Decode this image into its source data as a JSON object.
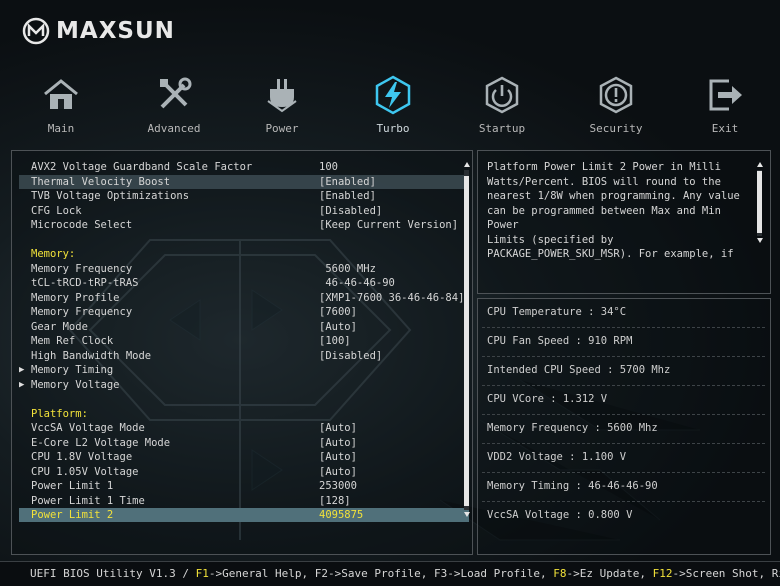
{
  "brand": {
    "name": "MAXSUN"
  },
  "nav": [
    {
      "label": "Main",
      "icon": "house-icon"
    },
    {
      "label": "Advanced",
      "icon": "tools-icon"
    },
    {
      "label": "Power",
      "icon": "power-plug-icon"
    },
    {
      "label": "Turbo",
      "icon": "turbo-bolt-icon",
      "active": true
    },
    {
      "label": "Startup",
      "icon": "power-button-icon"
    },
    {
      "label": "Security",
      "icon": "shield-icon"
    },
    {
      "label": "Exit",
      "icon": "exit-icon"
    }
  ],
  "settings": [
    {
      "label": "AVX2 Voltage Guardband Scale Factor",
      "value": "100"
    },
    {
      "label": "Thermal Velocity Boost",
      "value": "[Enabled]",
      "highlight": true
    },
    {
      "label": "TVB Voltage Optimizations",
      "value": "[Enabled]"
    },
    {
      "label": "CFG Lock",
      "value": "[Disabled]"
    },
    {
      "label": "Microcode Select",
      "value": "[Keep Current Version]"
    },
    {
      "label": "",
      "value": ""
    },
    {
      "label": "Memory:",
      "value": "",
      "section": true
    },
    {
      "label": "Memory Frequency",
      "value": " 5600 MHz"
    },
    {
      "label": "tCL-tRCD-tRP-tRAS",
      "value": " 46-46-46-90"
    },
    {
      "label": "Memory Profile",
      "value": "[XMP1-7600 36-46-46-84]"
    },
    {
      "label": "Memory Frequency",
      "value": "[7600]"
    },
    {
      "label": "Gear Mode",
      "value": "[Auto]"
    },
    {
      "label": "Mem Ref Clock",
      "value": "[100]"
    },
    {
      "label": "High Bandwidth Mode",
      "value": "[Disabled]"
    },
    {
      "label": "Memory Timing",
      "value": "",
      "submenu": true
    },
    {
      "label": "Memory Voltage",
      "value": "",
      "submenu": true
    },
    {
      "label": "",
      "value": ""
    },
    {
      "label": "Platform:",
      "value": "",
      "section": true
    },
    {
      "label": "VccSA Voltage Mode",
      "value": "[Auto]"
    },
    {
      "label": "E-Core L2 Voltage Mode",
      "value": "[Auto]"
    },
    {
      "label": "CPU 1.8V Voltage",
      "value": "[Auto]"
    },
    {
      "label": "CPU 1.05V Voltage",
      "value": "[Auto]"
    },
    {
      "label": "Power Limit 1",
      "value": "253000"
    },
    {
      "label": "Power Limit 1 Time",
      "value": "[128]"
    },
    {
      "label": "Power Limit 2",
      "value": "4095875",
      "selected": true
    }
  ],
  "help": {
    "text": "Platform Power Limit 2 Power in Milli\nWatts/Percent. BIOS will round to the\nnearest 1/8W when programming. Any value\ncan be programmed between Max and Min Power\nLimits (specified by\nPACKAGE_POWER_SKU_MSR). For example, if"
  },
  "info": [
    "CPU Temperature : 34°C",
    "CPU Fan Speed : 910 RPM",
    "Intended CPU Speed : 5700 Mhz",
    "CPU VCore : 1.312 V",
    "Memory Frequency : 5600 Mhz",
    "VDD2 Voltage : 1.100 V",
    "Memory Timing : 46-46-46-90",
    "VccSA Voltage : 0.800 V"
  ],
  "footer": {
    "prefix": "UEFI BIOS Utility V1.3 / ",
    "f1_key": "F1",
    "f1_action": "->General Help, ",
    "f2_key": "F2",
    "f2_action": "->Save Profile, ",
    "f3_key": "F3",
    "f3_action": "->Load Profile, ",
    "f8_key": "F8",
    "f8_action": "->Ez Update, ",
    "f12_key": "F12",
    "f12_action": "->Screen Shot, Right"
  },
  "colors": {
    "accent_yellow": "#f2e23a",
    "turbo_cyan": "#3ec7f0",
    "selected_row": "#50707a"
  }
}
